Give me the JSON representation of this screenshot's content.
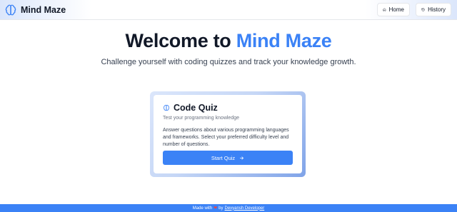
{
  "header": {
    "brand": "Mind Maze",
    "nav": {
      "home_label": "Home",
      "history_label": "History"
    }
  },
  "hero": {
    "title_prefix": "Welcome to ",
    "title_accent": "Mind Maze",
    "subtitle": "Challenge yourself with coding quizzes and track your knowledge growth."
  },
  "card": {
    "title": "Code Quiz",
    "subtitle": "Test your programming knowledge",
    "description": "Answer questions about various programming languages and frameworks. Select your preferred difficulty level and number of questions.",
    "button_label": "Start Quiz"
  },
  "footer": {
    "made_with": "Made with",
    "by": "by",
    "author": "Devyansh Developer"
  },
  "icons": {
    "brand": "brain-icon",
    "home": "home-icon",
    "history": "history-icon",
    "card": "brain-icon",
    "button": "arrow-right-icon",
    "footer": "heart-icon"
  },
  "colors": {
    "accent": "#3b82f6",
    "heart": "#ef4444",
    "text": "#111827"
  }
}
